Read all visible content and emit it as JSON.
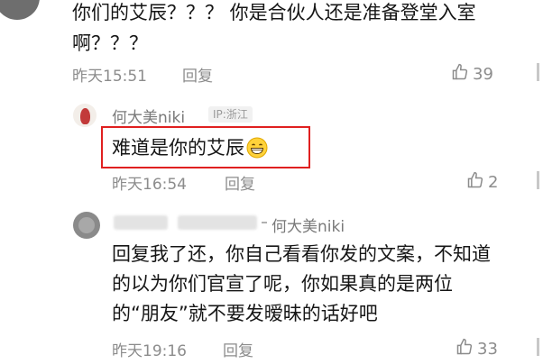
{
  "comment_top": {
    "text_line1": "你们的艾辰？？？ 你是合伙人还是准备登堂入室",
    "text_line2": "啊？？？",
    "time": "昨天15:51",
    "reply_label": "回复",
    "likes": "39"
  },
  "reply1": {
    "username": "何大美niki",
    "ip": "IP:浙江",
    "text": "难道是你的艾辰",
    "emoji": "grinning-face-icon",
    "time": "昨天16:54",
    "reply_label": "回复",
    "likes": "2",
    "highlight_color": "#e02020"
  },
  "reply2": {
    "reply_to": "何大美niki",
    "text_line1": "回复我了还，你自己看看你发的文案，不知道",
    "text_line2": "的以为你们官宣了呢，你如果真的是两位",
    "text_line3": "的“朋友”就不要发暧昧的话好吧",
    "time": "昨天19:16",
    "reply_label": "回复",
    "likes": "33"
  }
}
